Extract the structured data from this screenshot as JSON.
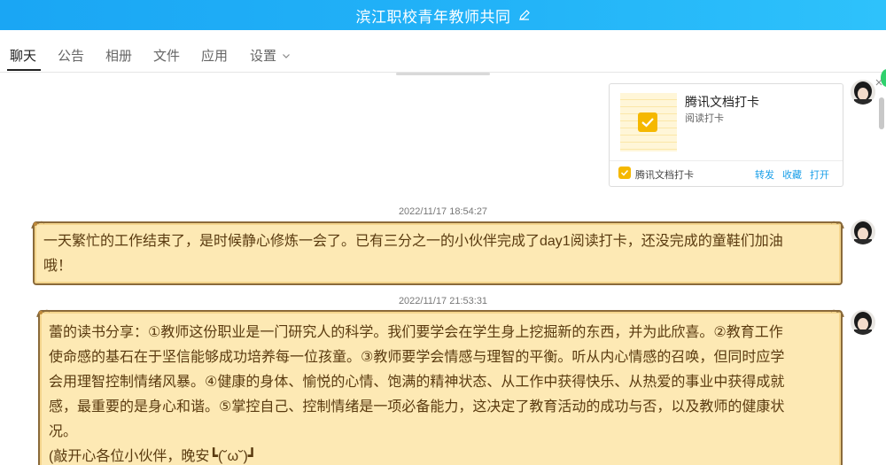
{
  "window": {
    "title": "滨江职校青年教师共同"
  },
  "tabs": [
    {
      "label": "聊天",
      "active": true
    },
    {
      "label": "公告",
      "active": false
    },
    {
      "label": "相册",
      "active": false
    },
    {
      "label": "文件",
      "active": false
    },
    {
      "label": "应用",
      "active": false
    },
    {
      "label": "设置",
      "active": false
    }
  ],
  "card": {
    "title": "腾讯文档打卡",
    "subtitle": "阅读打卡",
    "app_name": "腾讯文档打卡",
    "actions": [
      "转发",
      "收藏",
      "打开"
    ]
  },
  "messages": [
    {
      "timestamp": "2022/11/17 18:54:27",
      "lines": [
        "一天繁忙的工作结束了，是时候静心修炼一会了。已有三分之一的小伙伴完成了day1阅读打卡，还没完成的童鞋们加油",
        "哦！"
      ]
    },
    {
      "timestamp": "2022/11/17 21:53:31",
      "lines": [
        "蕾的读书分享：①教师这份职业是一门研究人的科学。我们要学会在学生身上挖掘新的东西，并为此欣喜。②教育工作",
        "使命感的基石在于坚信能够成功培养每一位孩童。③教师要学会情感与理智的平衡。听从内心情感的召唤，但同时应学",
        "会用理智控制情绪风暴。④健康的身体、愉悦的心情、饱满的精神状态、从工作中获得快乐、从热爱的事业中获得成就",
        "感，最重要的是身心和谐。⑤掌控自己、控制情绪是一项必备能力，这决定了教育活动的成功与否，以及教师的健康状",
        "况。",
        "(敲开心各位小伙伴，晚安┗(˘ω˘)┛"
      ]
    }
  ],
  "colors": {
    "titlebar": "#1aa6f4",
    "bubble_bg": "#fde9b4",
    "bubble_border": "#8a6a3a",
    "bubble_text": "#5a3b10",
    "link": "#1a9fe8",
    "card_accent": "#f5b800"
  },
  "icons": {
    "title_edit": "pencil-icon",
    "settings_dropdown": "chevron-down-icon",
    "card_check": "checkbox-icon",
    "card_app": "shield-check-icon"
  }
}
